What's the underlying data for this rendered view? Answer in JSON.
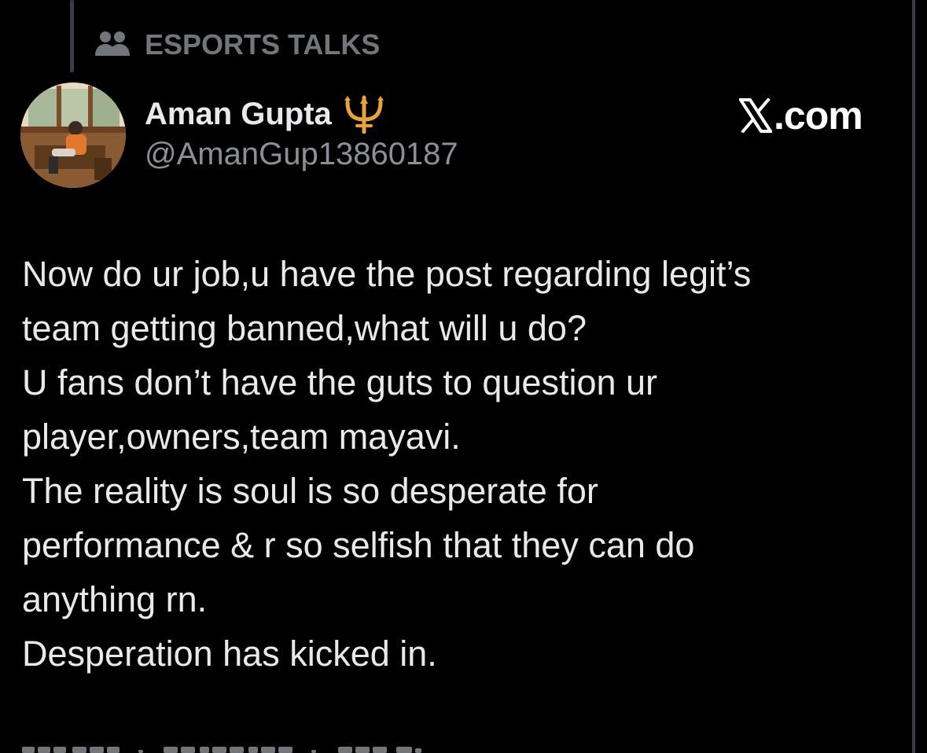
{
  "community": {
    "icon": "community-people-icon",
    "label": "ESPORTS TALKS"
  },
  "author": {
    "display_name": "Aman Gupta",
    "name_emoji": "trident-icon",
    "handle": "@AmanGup13860187",
    "avatar": "avatar-photo"
  },
  "watermark": {
    "icon": "x-logo-icon",
    "text": ".com"
  },
  "tweet": {
    "lines": [
      "Now do ur job,u have the post regarding legit’s",
      "team getting banned,what will u do?",
      "U fans don’t have the guts to question ur",
      "player,owners,team mayavi.",
      "The reality is soul is so desperate for",
      "performance & r so selfish that they can do",
      "anything rn.",
      "Desperation has kicked in."
    ]
  },
  "colors": {
    "background": "#000000",
    "primary_text": "#e7e9ea",
    "secondary_text": "#71767b",
    "trident": "#e8a33a"
  }
}
